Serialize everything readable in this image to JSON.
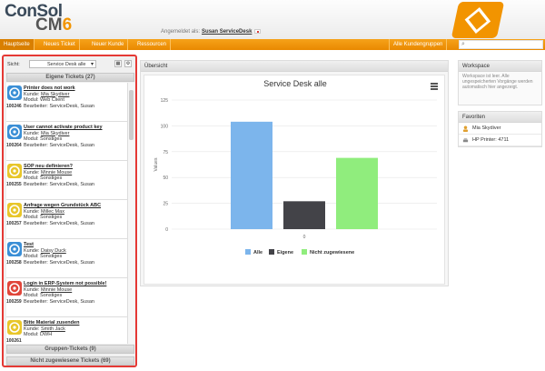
{
  "header": {
    "logo_top": "ConSol",
    "logo_cm": "CM",
    "logo_num": "6",
    "login_label": "Angemeldet als:",
    "login_user": "Susan ServiceDesk"
  },
  "nav": {
    "items": [
      "Hauptseite",
      "Neues Ticket",
      "Neuer Kunde",
      "Ressourcen"
    ],
    "right": "Alle Kundengruppen"
  },
  "search": {
    "icon": "search-icon",
    "placeholder": ""
  },
  "left": {
    "sicht_label": "Sicht:",
    "sicht_value": "Service Desk alle",
    "own_header": "Eigene Tickets (27)",
    "group_header": "Gruppen-Tickets (9)",
    "unassigned_header": "Nicht zugewiesene Tickets (69)",
    "tickets": [
      {
        "number": "100246",
        "title": "Printer does not work",
        "customer": "Mia Skydiver",
        "module": "Web Client",
        "editor": "ServiceDesk, Susan",
        "color": "#3b8fd6",
        "icon": "gear-icon"
      },
      {
        "number": "100264",
        "title": "User cannot activate product key",
        "customer": "Mia Skydiver",
        "module": "Sonstiges",
        "editor": "ServiceDesk, Susan",
        "color": "#3b8fd6",
        "icon": "gear-icon"
      },
      {
        "number": "100255",
        "title": "SOP neu definieren?",
        "customer": "Minnie Mouse",
        "module": "Sonstiges",
        "editor": "ServiceDesk, Susan",
        "color": "#e8c62a",
        "icon": "arrow-icon"
      },
      {
        "number": "100257",
        "title": "Anfrage wegen Grundstück ABC",
        "customer": "Millec Max",
        "module": "Sonstiges",
        "editor": "ServiceDesk, Susan",
        "color": "#e8c62a",
        "icon": "arrow-icon"
      },
      {
        "number": "100258",
        "title": "Test",
        "customer": "Daisy Duck",
        "module": "Sonstiges",
        "editor": "ServiceDesk, Susan",
        "color": "#3b8fd6",
        "icon": "arrow-icon"
      },
      {
        "number": "100259",
        "title": "Login in ERP-System not possible!",
        "customer": "Minnie Mouse",
        "module": "Sonstiges",
        "editor": "ServiceDesk, Susan",
        "color": "#e0463a",
        "icon": "arrow-icon"
      },
      {
        "number": "100261",
        "title": "Bitte Material zusenden",
        "customer": "Smith Jack",
        "module": "DWH",
        "editor": "",
        "color": "#e8c62a",
        "icon": "arrow-icon"
      }
    ],
    "labels": {
      "customer": "Kunde:",
      "module": "Modul:",
      "editor": "Bearbeiter:"
    }
  },
  "overview": {
    "header": "Übersicht"
  },
  "chart_data": {
    "type": "bar",
    "title": "Service Desk alle",
    "xlabel": "",
    "ylabel": "Values",
    "categories": [
      "0"
    ],
    "ylim": [
      0,
      125
    ],
    "yticks": [
      0,
      25,
      50,
      75,
      100,
      125
    ],
    "series": [
      {
        "name": "Alle",
        "values": [
          104
        ],
        "color": "#7cb5ec"
      },
      {
        "name": "Eigene",
        "values": [
          27
        ],
        "color": "#434348"
      },
      {
        "name": "Nicht zugewiesene",
        "values": [
          69
        ],
        "color": "#90ed7d"
      }
    ],
    "legend": "bottom",
    "grid": true
  },
  "workspace": {
    "header": "Workspace",
    "text": "Workspace ist leer. Alle ungespeicherten Vorgänge werden automatisch hier angezeigt."
  },
  "favorites": {
    "header": "Favoriten",
    "items": [
      {
        "label": "Mia Skydiver",
        "icon": "person-icon"
      },
      {
        "label": "HP Printer: 4711",
        "icon": "printer-icon"
      }
    ]
  }
}
